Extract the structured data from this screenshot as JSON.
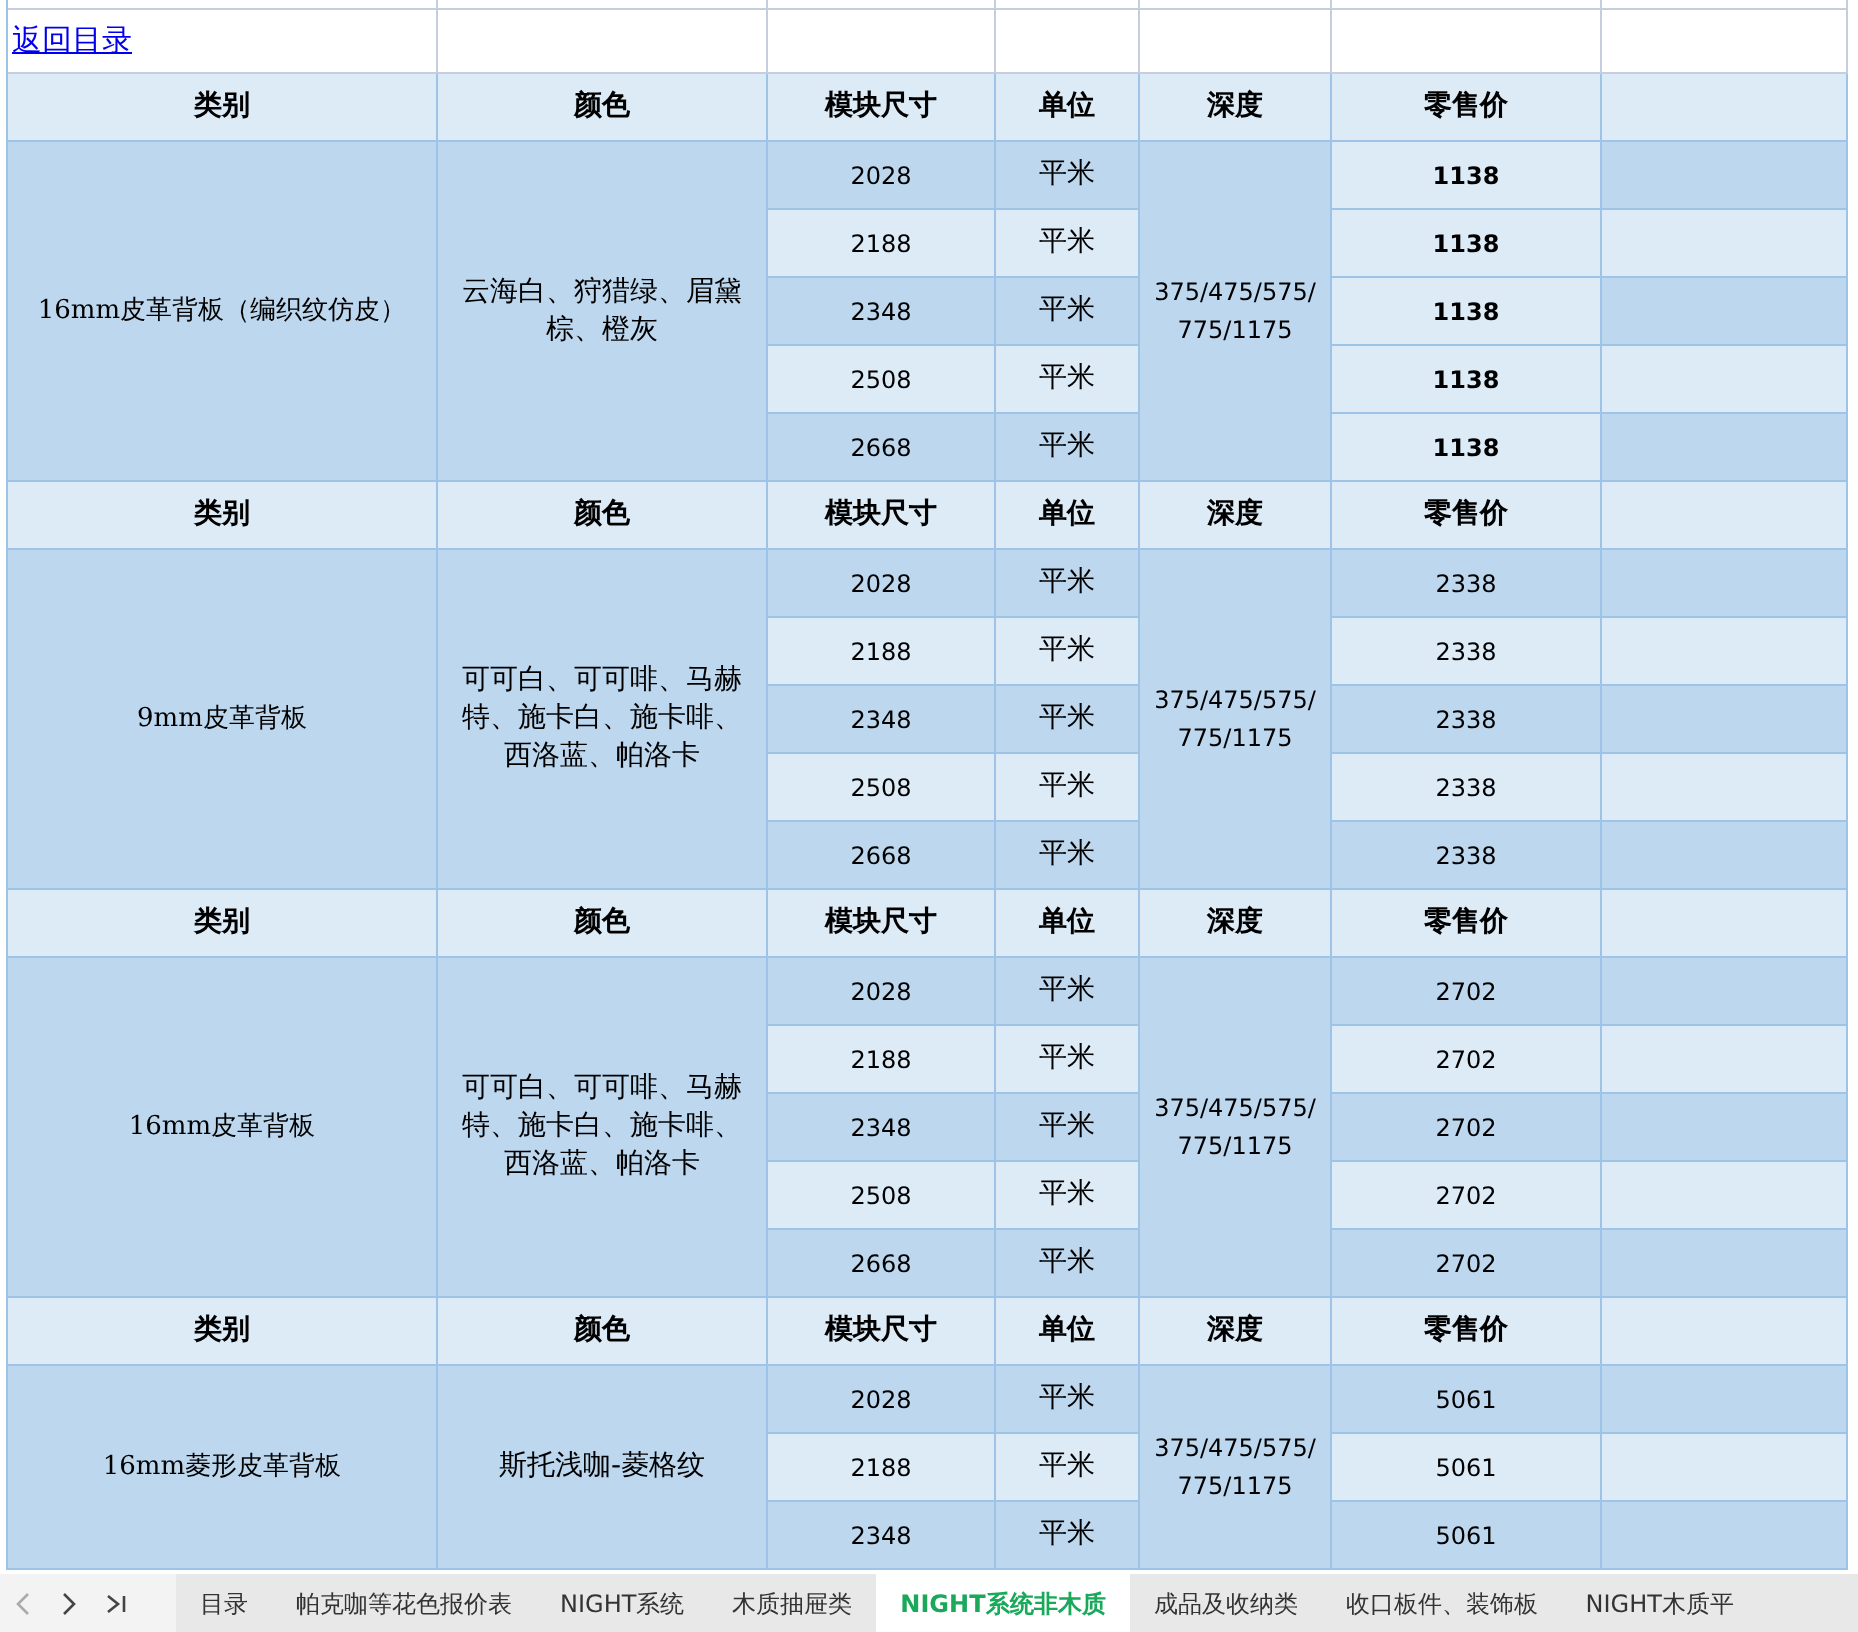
{
  "link": "返回目录",
  "groups": [
    {
      "headers": [
        "类别",
        "颜色",
        "模块尺寸",
        "单位",
        "深度",
        "零售价"
      ],
      "category": "16mm皮革背板（编织纹仿皮）",
      "colors": "云海白、狩猎绿、眉黛棕、橙灰",
      "depth": "375/475/575/775/1175",
      "emphasized": true,
      "rows": [
        {
          "size": "2028",
          "unit": "平米",
          "price": "1138"
        },
        {
          "size": "2188",
          "unit": "平米",
          "price": "1138"
        },
        {
          "size": "2348",
          "unit": "平米",
          "price": "1138"
        },
        {
          "size": "2508",
          "unit": "平米",
          "price": "1138"
        },
        {
          "size": "2668",
          "unit": "平米",
          "price": "1138"
        }
      ]
    },
    {
      "headers": [
        "类别",
        "颜色",
        "模块尺寸",
        "单位",
        "深度",
        "零售价"
      ],
      "category": "9mm皮革背板",
      "colors": "可可白、可可啡、马赫特、施卡白、施卡啡、西洛蓝、帕洛卡",
      "depth": "375/475/575/775/1175",
      "emphasized": false,
      "rows": [
        {
          "size": "2028",
          "unit": "平米",
          "price": "2338"
        },
        {
          "size": "2188",
          "unit": "平米",
          "price": "2338"
        },
        {
          "size": "2348",
          "unit": "平米",
          "price": "2338"
        },
        {
          "size": "2508",
          "unit": "平米",
          "price": "2338"
        },
        {
          "size": "2668",
          "unit": "平米",
          "price": "2338"
        }
      ]
    },
    {
      "headers": [
        "类别",
        "颜色",
        "模块尺寸",
        "单位",
        "深度",
        "零售价"
      ],
      "category": "16mm皮革背板",
      "colors": "可可白、可可啡、马赫特、施卡白、施卡啡、西洛蓝、帕洛卡",
      "depth": "375/475/575/775/1175",
      "emphasized": false,
      "rows": [
        {
          "size": "2028",
          "unit": "平米",
          "price": "2702"
        },
        {
          "size": "2188",
          "unit": "平米",
          "price": "2702"
        },
        {
          "size": "2348",
          "unit": "平米",
          "price": "2702"
        },
        {
          "size": "2508",
          "unit": "平米",
          "price": "2702"
        },
        {
          "size": "2668",
          "unit": "平米",
          "price": "2702"
        }
      ]
    },
    {
      "headers": [
        "类别",
        "颜色",
        "模块尺寸",
        "单位",
        "深度",
        "零售价"
      ],
      "category": "16mm菱形皮革背板",
      "colors": "斯托浅咖-菱格纹",
      "depth": "375/475/575/775/1175",
      "emphasized": false,
      "rows": [
        {
          "size": "2028",
          "unit": "平米",
          "price": "5061"
        },
        {
          "size": "2188",
          "unit": "平米",
          "price": "5061"
        },
        {
          "size": "2348",
          "unit": "平米",
          "price": "5061"
        }
      ]
    }
  ],
  "sheet_tabs": [
    {
      "label": "目录",
      "selected": false
    },
    {
      "label": "帕克咖等花色报价表",
      "selected": false
    },
    {
      "label": "NIGHT系统",
      "selected": false
    },
    {
      "label": "木质抽屉类",
      "selected": false
    },
    {
      "label": "NIGHT系统非木质",
      "selected": true
    },
    {
      "label": "成品及收纳类",
      "selected": false
    },
    {
      "label": "收口板件、装饰板",
      "selected": false
    },
    {
      "label": "NIGHT木质平",
      "selected": false
    }
  ]
}
